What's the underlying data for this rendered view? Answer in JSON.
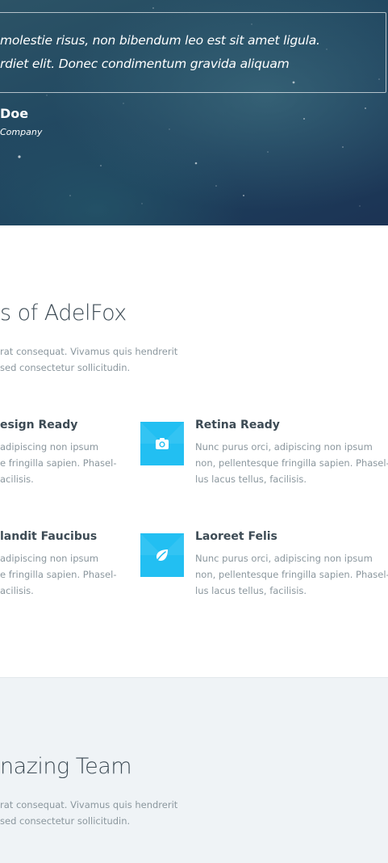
{
  "testimonial": {
    "quote_line_1": "molestie risus, non bibendum leo est sit amet ligula.",
    "quote_line_2": "rdiet elit. Donec condimentum gravida aliquam",
    "author": "Doe",
    "company": "Company"
  },
  "features": {
    "title": "s of AdelFox",
    "intro_line_1": "rat consequat. Vivamus quis hendrerit",
    "intro_line_2": " sed consectetur sollicitudin.",
    "items": [
      {
        "title": "esign Ready",
        "lines": [
          " adipiscing non ipsum",
          "e fringilla sapien. Phasel-",
          "acilisis."
        ]
      },
      {
        "title": "Retina Ready",
        "icon": "camera-icon",
        "lines": [
          "Nunc purus orci, adipiscing non ipsum",
          "non, pellentesque fringilla sapien. Phasel-",
          "lus lacus tellus, facilisis."
        ]
      },
      {
        "title": "landit Faucibus",
        "lines": [
          " adipiscing non ipsum",
          "e fringilla sapien. Phasel-",
          "acilisis."
        ]
      },
      {
        "title": "Laoreet Felis",
        "icon": "leaf-icon",
        "lines": [
          "Nunc purus orci, adipiscing non ipsum",
          "non, pellentesque fringilla sapien. Phasel-",
          "lus lacus tellus, facilisis."
        ]
      }
    ]
  },
  "team": {
    "title": "nazing Team",
    "intro_line_1": "rat consequat. Vivamus quis hendrerit",
    "intro_line_2": " sed consectetur sollicitudin."
  },
  "colors": {
    "accent": "#22bff2",
    "heading": "#3d4b55",
    "body_text": "#8b979e",
    "team_background": "#eff3f6"
  }
}
